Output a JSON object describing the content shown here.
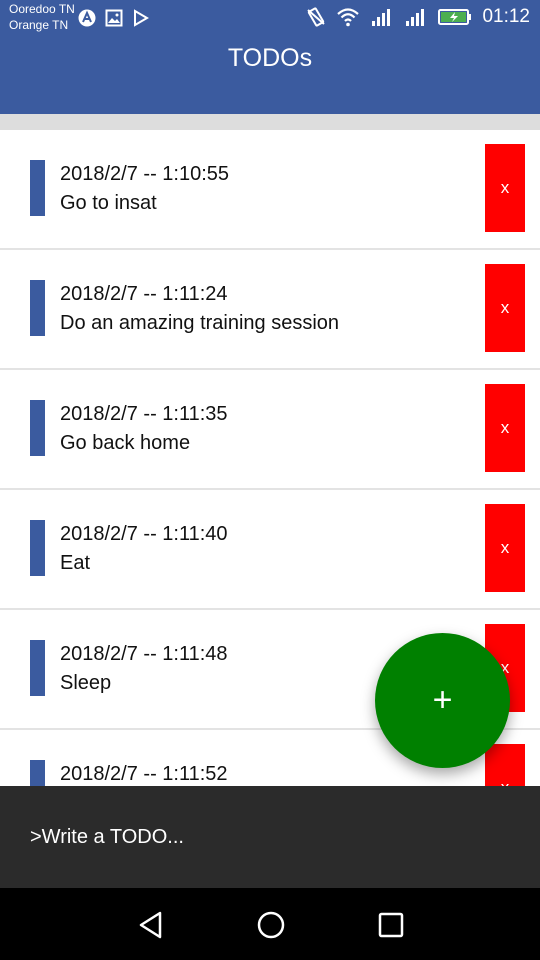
{
  "status_bar": {
    "carrier_1": "Ooredoo TN",
    "carrier_2": "Orange TN",
    "time": "01:12",
    "notification_icons": [
      "app-icon",
      "image-icon",
      "play-store-icon"
    ],
    "system_icons": [
      "vibrate-icon",
      "wifi-icon",
      "signal-icon",
      "signal-icon",
      "battery-charging-icon"
    ]
  },
  "app_bar": {
    "title": "TODOs",
    "color": "#3b5b9f"
  },
  "todos": [
    {
      "date": "2018/2/7 -- 1:10:55",
      "text": "Go to insat",
      "delete_label": "x"
    },
    {
      "date": "2018/2/7 -- 1:11:24",
      "text": "Do an amazing training session",
      "delete_label": "x"
    },
    {
      "date": "2018/2/7 -- 1:11:35",
      "text": "Go back home",
      "delete_label": "x"
    },
    {
      "date": "2018/2/7 -- 1:11:40",
      "text": "Eat",
      "delete_label": "x"
    },
    {
      "date": "2018/2/7 -- 1:11:48",
      "text": "Sleep",
      "delete_label": "x"
    },
    {
      "date": "2018/2/7 -- 1:11:52",
      "text": "",
      "delete_label": "x"
    }
  ],
  "fab": {
    "label": "+",
    "color": "#008000"
  },
  "composer": {
    "placeholder": ">Write a TODO..."
  },
  "nav_bar": {
    "buttons": [
      "back-icon",
      "home-icon",
      "recents-icon"
    ]
  },
  "colors": {
    "delete": "#ff0000",
    "accent_bar": "#3b5b9f",
    "composer_bg": "#2b2b2b"
  }
}
